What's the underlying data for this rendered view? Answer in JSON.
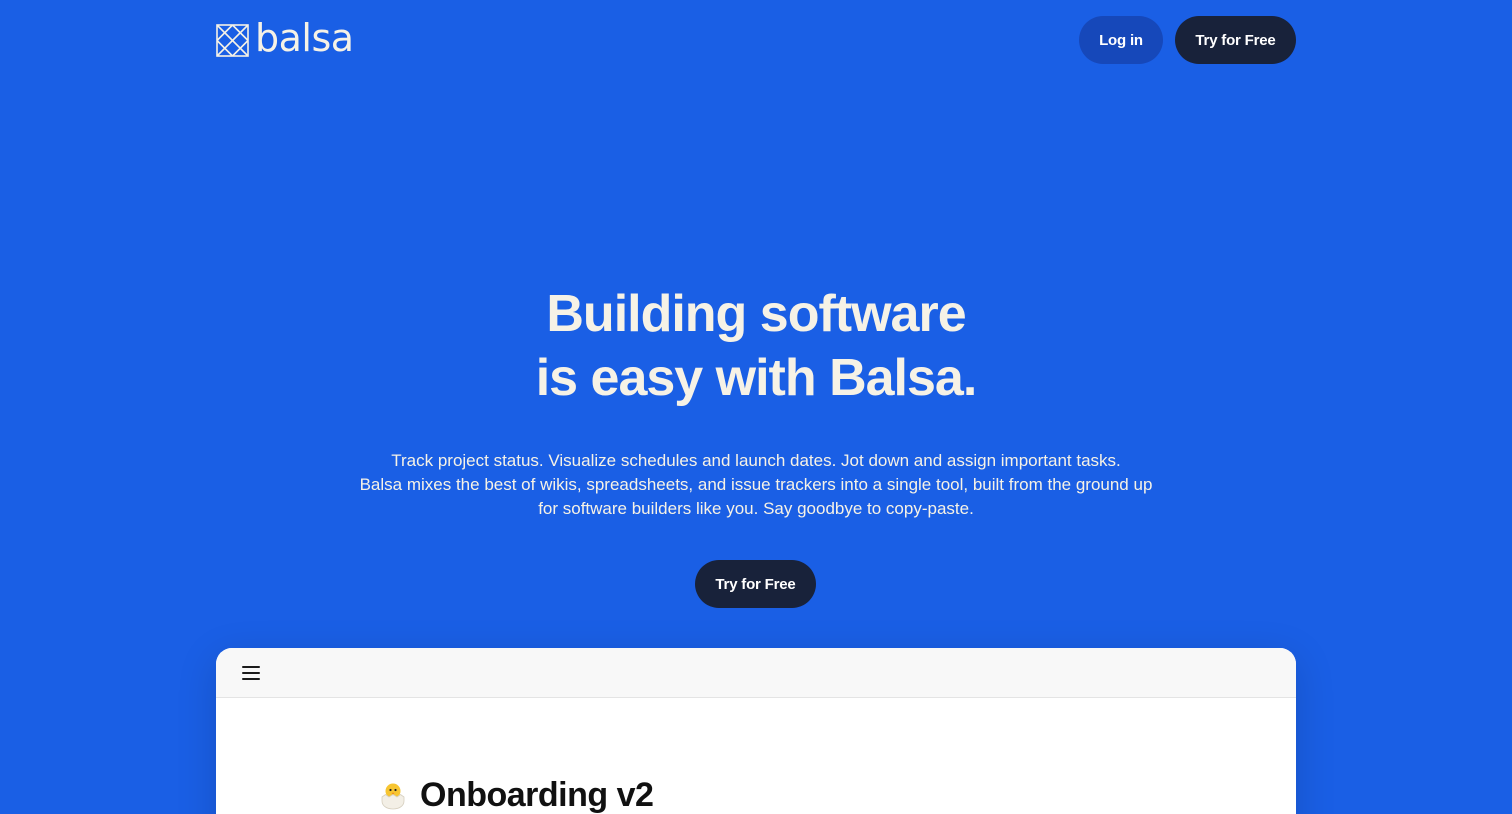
{
  "header": {
    "logo_text": "balsa",
    "login_label": "Log in",
    "try_label": "Try for Free"
  },
  "hero": {
    "title_lines": [
      "Building software",
      "is easy with Balsa."
    ],
    "subtitle_lines": [
      "Track project status. Visualize schedules and launch dates. Jot down and assign important tasks.",
      "Balsa mixes the best of wikis, spreadsheets, and issue trackers into a single tool, built from the ground up",
      "for software builders like you. Say goodbye to copy-paste."
    ],
    "cta_label": "Try for Free"
  },
  "preview": {
    "doc_title": "Onboarding v2",
    "doc_icon": "hatching-chick-icon"
  },
  "colors": {
    "background": "#1a5fe5",
    "login_button": "#1648ba",
    "dark_button": "#18223a",
    "hero_text": "#f6f2e6"
  }
}
